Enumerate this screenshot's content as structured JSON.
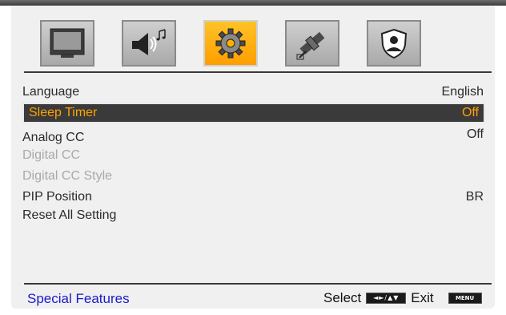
{
  "tabs": [
    {
      "id": "picture",
      "icon": "tv-icon",
      "active": false
    },
    {
      "id": "sound",
      "icon": "speaker-music-icon",
      "active": false
    },
    {
      "id": "features",
      "icon": "gear-icon",
      "active": true
    },
    {
      "id": "channel",
      "icon": "satellite-icon",
      "active": false
    },
    {
      "id": "lock",
      "icon": "lock-shield-icon",
      "active": false
    }
  ],
  "menu": {
    "items": [
      {
        "label": "Language",
        "value": "English",
        "state": "normal"
      },
      {
        "label": "Sleep Timer",
        "value": "Off",
        "state": "selected"
      },
      {
        "label": "Analog  CC",
        "value": "Off",
        "state": "normal"
      },
      {
        "label": "Digital  CC",
        "value": "",
        "state": "disabled"
      },
      {
        "label": "Digital  CC  Style",
        "value": "",
        "state": "disabled"
      },
      {
        "label": "PIP  Position",
        "value": "BR",
        "state": "normal"
      },
      {
        "label": "Reset All Setting",
        "value": "",
        "state": "normal"
      }
    ]
  },
  "footer": {
    "title": "Special  Features",
    "select_label": "Select",
    "nav_key": "◄►/▲▼",
    "exit_label": "Exit",
    "menu_key": "MENU"
  },
  "colors": {
    "highlight_text": "#ffa200",
    "highlight_bg": "#3a3a3a",
    "active_tab": "#ffb000",
    "footer_title": "#1a1acc"
  }
}
